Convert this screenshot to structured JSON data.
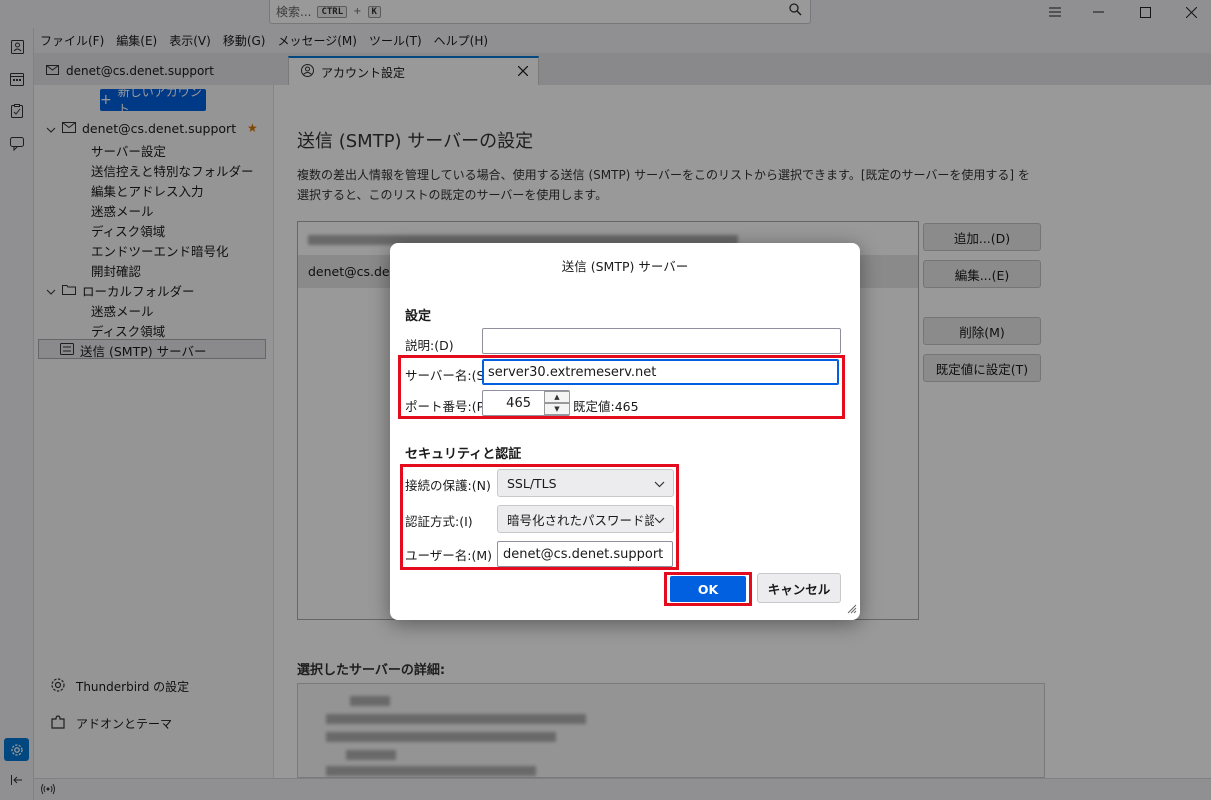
{
  "titlebar": {
    "search_placeholder": "検索...",
    "kbd_ctrl": "CTRL",
    "kbd_plus": "+",
    "kbd_k": "K"
  },
  "menubar": [
    "ファイル(F)",
    "編集(E)",
    "表示(V)",
    "移動(G)",
    "メッセージ(M)",
    "ツール(T)",
    "ヘルプ(H)"
  ],
  "tabs": [
    {
      "label": "denet@cs.denet.support"
    },
    {
      "label": "アカウント設定"
    }
  ],
  "sidebar": {
    "new_account": "新しいアカウント",
    "account": "denet@cs.denet.support",
    "account_items": [
      "サーバー設定",
      "送信控えと特別なフォルダー",
      "編集とアドレス入力",
      "迷惑メール",
      "ディスク領域",
      "エンドツーエンド暗号化",
      "開封確認"
    ],
    "local_folders": "ローカルフォルダー",
    "local_items": [
      "迷惑メール",
      "ディスク領域"
    ],
    "smtp": "送信 (SMTP) サーバー",
    "settings": "Thunderbird の設定",
    "addons": "アドオンとテーマ"
  },
  "main": {
    "title": "送信 (SMTP) サーバーの設定",
    "desc": "複数の差出人情報を管理している場合、使用する送信 (SMTP) サーバーをこのリストから選択できます。[既定のサーバーを使用する] を選択すると、このリストの既定のサーバーを使用します。",
    "server_row2": "denet@cs.dene",
    "btn_add": "追加...(D)",
    "btn_edit": "編集...(E)",
    "btn_delete": "削除(M)",
    "btn_default": "既定値に設定(T)",
    "details_title": "選択したサーバーの詳細:"
  },
  "dialog": {
    "title": "送信 (SMTP) サーバー",
    "section_settings": "設定",
    "label_desc": "説明:(D)",
    "desc_value": "",
    "label_server": "サーバー名:(S)",
    "server_value": "server30.extremeserv.net",
    "label_port": "ポート番号:(P)",
    "port_value": "465",
    "port_default": "既定値:465",
    "section_security": "セキュリティと認証",
    "label_conn": "接続の保護:(N)",
    "conn_value": "SSL/TLS",
    "label_auth": "認証方式:(I)",
    "auth_value": "暗号化されたパスワード認証",
    "label_user": "ユーザー名:(M)",
    "user_value": "denet@cs.denet.support",
    "ok": "OK",
    "cancel": "キャンセル"
  },
  "colors": {
    "accent": "#0060df",
    "highlight": "#e30b1c"
  }
}
